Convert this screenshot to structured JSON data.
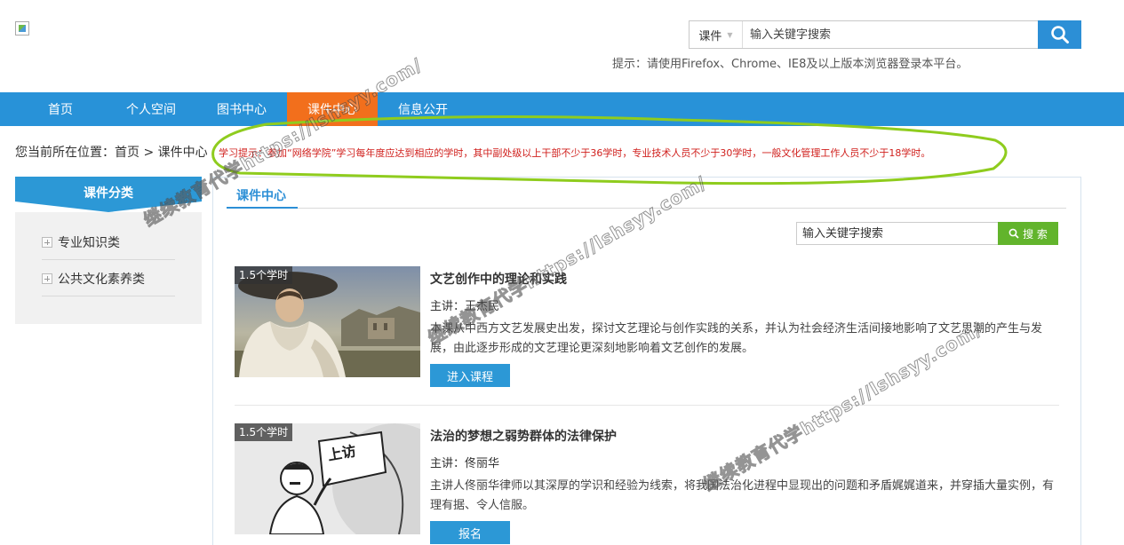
{
  "header": {
    "search_type": "课件",
    "search_placeholder": "输入关键字搜索",
    "tip": "提示：请使用Firefox、Chrome、IE8及以上版本浏览器登录本平台。"
  },
  "nav": {
    "items": [
      {
        "label": "首页"
      },
      {
        "label": "个人空间"
      },
      {
        "label": "图书中心"
      },
      {
        "label": "课件中心"
      },
      {
        "label": "信息公开"
      }
    ],
    "active_color": "#f26f1c",
    "bar_color": "#2892d8"
  },
  "breadcrumb": "您当前所在位置：首页 > 课件中心",
  "notice": "学习提示：参加“网络学院”学习每年度应达到相应的学时，其中副处级以上干部不少于36学时，专业技术人员不少于30学时，一般文化管理工作人员不少于18学时。",
  "sidebar": {
    "title": "课件分类",
    "items": [
      {
        "label": "专业知识类"
      },
      {
        "label": "公共文化素养类"
      }
    ]
  },
  "main": {
    "tab": "课件中心",
    "search_placeholder": "输入关键字搜索",
    "search_button": "搜 索",
    "courses": [
      {
        "hours": "1.5个学时",
        "title": "文艺创作中的理论和实践",
        "teacher": "主讲：王杰民",
        "desc": "本课从中西方文艺发展史出发，探讨文艺理论与创作实践的关系，并认为社会经济生活间接地影响了文艺思潮的产生与发展，由此逐步形成的文艺理论更深刻地影响着文艺创作的发展。",
        "button": "进入课程"
      },
      {
        "hours": "1.5个学时",
        "title": "法治的梦想之弱势群体的法律保护",
        "teacher": "主讲：佟丽华",
        "desc": "主讲人佟丽华律师以其深厚的学识和经验为线索，将我国法治化进程中显现出的问题和矛盾娓娓道来，并穿插大量实例，有理有据、令人信服。",
        "button": "报名",
        "sign_text": "上访"
      }
    ]
  },
  "watermark": "继续教育代学https://lshsyy.com/"
}
